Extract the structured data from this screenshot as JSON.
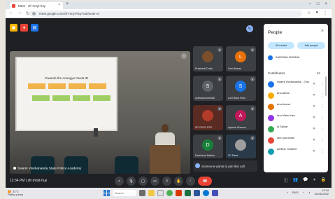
{
  "browser": {
    "tab_title": "Meet - zfr-mnyt-huy",
    "tab_close": "×",
    "new_tab": "+",
    "url": "meet.google.com/zfr-mnyt-huy?authuser=0",
    "win_min": "–",
    "win_max": "□",
    "win_close": "×"
  },
  "meet": {
    "stage_label": "Swami Vivekananda State Police Academy",
    "slide_title": "Towards the Anangya Geeta ID",
    "slide_boxes": [
      "",
      "",
      "",
      "",
      "",
      "",
      "",
      ""
    ],
    "notice": "Someone wants to join this call",
    "time": "12:34 PM",
    "separator": "|",
    "meeting_code": "zfr-mnyt-huy",
    "tiles": [
      {
        "initial": "",
        "name": "Prashanti Dutta",
        "color": "#7b4f2c"
      },
      {
        "initial": "L",
        "name": "Lina Biswas",
        "color": "#e8710a"
      },
      {
        "initial": "S",
        "name": "subhadra Mondal",
        "color": "#5f6368"
      },
      {
        "initial": "S",
        "name": "Lovi Rana Rani",
        "color": "#1a73e8"
      },
      {
        "initial": "",
        "name": "SP CSCG FSP",
        "color": "#b33b2a"
      },
      {
        "initial": "A",
        "name": "Ayesha Sharma",
        "color": "#c2185b"
      },
      {
        "initial": "D",
        "name": "Darshana Naskar",
        "color": "#188038"
      },
      {
        "initial": "",
        "name": "SP Rana",
        "color": "#9e9e9e"
      }
    ]
  },
  "panel": {
    "title": "People",
    "close": "×",
    "add_people": "Add people",
    "mute_all": "All muted",
    "host_name": "SANTANU MONDAL",
    "section_title": "Contributors",
    "section_count": "58",
    "people": [
      {
        "name": "Swami Vivekananda... (You)",
        "sub": "",
        "color": "#1a73e8"
      },
      {
        "name": "Anu Abhat",
        "sub": "",
        "color": "#f9ab00"
      },
      {
        "name": "Anu Aroma",
        "sub": "",
        "color": "#e37400"
      },
      {
        "name": "Anu Manu Irisa",
        "sub": "",
        "color": "#9334e6"
      },
      {
        "name": "Al Sarkar",
        "sub": "",
        "color": "#34a853"
      },
      {
        "name": "arun pal achari",
        "sub": "",
        "color": "#e8453c"
      },
      {
        "name": "AMRUL SHAIKH",
        "sub": "",
        "color": "#129eaf"
      }
    ]
  },
  "taskbar": {
    "weather_temp": "32°C",
    "weather_desc": "Partly sunny",
    "search_label": "Search",
    "time": "12:34",
    "date": "26-08-2022",
    "lang": "ENG"
  }
}
